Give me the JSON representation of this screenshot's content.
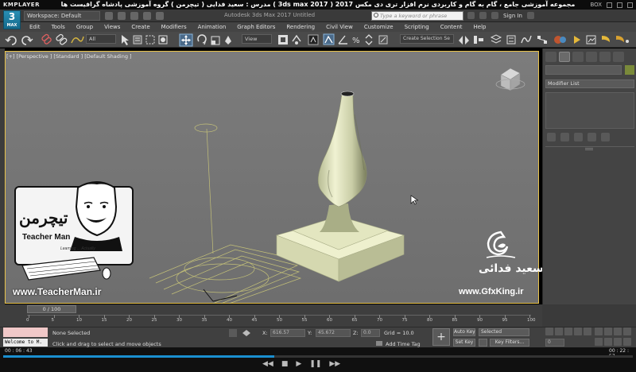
{
  "player": {
    "name": "KMPLAYER",
    "caption": "مجموعه آموزشی جامع ، گام به گام و کاربردی نرم افزار تری دی مکس 2017 ( 3ds max 2017 ) مدرس : سعید فدایی ( تیچرمن ) گروه آموزشی پادشاه گرافیست ها",
    "right_label": "BOX",
    "elapsed": "00 : 06 : 43",
    "total": "00 : 22 : 57",
    "progress": 0.43
  },
  "max": {
    "icon_label": "MAX",
    "icon_number": "3",
    "workspace": "Workspace: Default",
    "app_title": "Autodesk 3ds Max 2017    Untitled",
    "search_placeholder": "Type a keyword or phrase",
    "sign_in": "Sign In"
  },
  "menu": [
    "Edit",
    "Tools",
    "Group",
    "Views",
    "Create",
    "Modifiers",
    "Animation",
    "Graph Editors",
    "Rendering",
    "Civil View",
    "Customize",
    "Scripting",
    "Content",
    "Help"
  ],
  "toolbar": {
    "selection_filter": "All",
    "ref_coord": "View",
    "create_selection_set": "Create Selection Se"
  },
  "viewport": {
    "label": "[+] [Perspective ] [Standard ] [Default Shading ]"
  },
  "command_panel": {
    "modifier_list": "Modifier List",
    "accent_color": "#7a8a3a"
  },
  "watermarks": {
    "teacherman_fa": "تیچرمن",
    "teacherman_en": "Teacher Man",
    "teacherman_sub": "Learning ... Actually",
    "teacherman_url": "www.TeacherMan.ir",
    "gfx_name": "سعید فدائی",
    "gfx_url": "www.GfxKing.ir"
  },
  "timeline": {
    "slider": "0 / 100",
    "ticks": [
      "0",
      "5",
      "10",
      "15",
      "20",
      "25",
      "30",
      "35",
      "40",
      "45",
      "50",
      "55",
      "60",
      "65",
      "70",
      "75",
      "80",
      "85",
      "90",
      "95",
      "100"
    ]
  },
  "status": {
    "listener": "Welcome to M.",
    "selection": "None Selected",
    "prompt": "Click and drag to select and move objects",
    "x_label": "X:",
    "x_value": "616.57",
    "y_label": "Y:",
    "y_value": "45.672",
    "z_label": "Z:",
    "z_value": "0.0",
    "grid": "Grid = 10.0",
    "add_time_tag": "Add Time Tag",
    "auto_key": "Auto Key",
    "selected": "Selected",
    "set_key": "Set Key",
    "key_filters": "Key Filters...",
    "frame": "0"
  }
}
